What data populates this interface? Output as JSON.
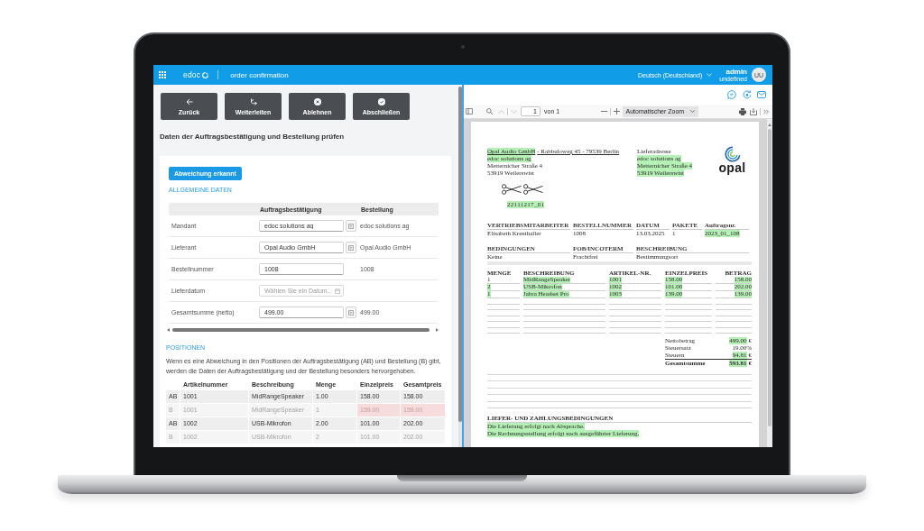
{
  "app_bar": {
    "product": "edoc",
    "title": "order confirmation",
    "language": "Deutsch (Deutschland)",
    "user": {
      "name": "admin",
      "role": "undefined",
      "initials": "UU"
    }
  },
  "actions": [
    {
      "kind": "back",
      "label": "Zurück"
    },
    {
      "kind": "forward",
      "label": "Weiterleiten"
    },
    {
      "kind": "reject",
      "label": "Ablehnen"
    },
    {
      "kind": "complete",
      "label": "Abschließen"
    }
  ],
  "heading": "Daten der Auftragsbestätigung und Bestellung prüfen",
  "status_button": "Abweichung erkannt",
  "general_data": {
    "title": "ALLGEMEINE DATEN",
    "columns": [
      "Auftragsbestätigung",
      "Bestellung"
    ],
    "rows": [
      {
        "label": "Mandant",
        "kind": "lookup",
        "value": "edoc solutions ag",
        "order_value": "edoc solutions ag"
      },
      {
        "label": "Lieferant",
        "kind": "lookup",
        "value": "Opal Audio GmbH",
        "order_value": "Opal Audio GmbH"
      },
      {
        "label": "Bestellnummer",
        "kind": "text",
        "value": "1008",
        "order_value": "1008"
      },
      {
        "label": "Lieferdatum",
        "kind": "date",
        "placeholder": "Wählen Sie ein Datum..."
      },
      {
        "label": "Gesamtsumme (netto)",
        "kind": "lookup",
        "value": "499.00",
        "order_value": "499.00"
      }
    ]
  },
  "positions": {
    "title": "POSITIONEN",
    "note": "Wenn es eine Abweichung in den Positionen der Auftragsbestätigung (AB) und Bestellung (B) gibt, werden die Daten der Auftragsbestätigung und der Bestellung besonders hervorgehoben.",
    "columns": [
      "Artikelnummer",
      "Beschreibung",
      "Menge",
      "Einzelpreis",
      "Gesamtpreis"
    ],
    "rows": [
      {
        "kind": "confirmation",
        "source": "AB",
        "cells": [
          {
            "text": "1001",
            "deviation": false
          },
          {
            "text": "MidRangeSpeaker",
            "deviation": false
          },
          {
            "text": "1.00",
            "deviation": false
          },
          {
            "text": "158.00",
            "deviation": false
          },
          {
            "text": "158.00",
            "deviation": false
          }
        ]
      },
      {
        "kind": "order",
        "source": "B",
        "cells": [
          {
            "text": "1001",
            "deviation": false
          },
          {
            "text": "MidRangeSpeaker",
            "deviation": false
          },
          {
            "text": "1",
            "deviation": false
          },
          {
            "text": "159.00",
            "deviation": true
          },
          {
            "text": "159.00",
            "deviation": true
          }
        ]
      },
      {
        "kind": "confirmation",
        "source": "AB",
        "cells": [
          {
            "text": "1002",
            "deviation": false
          },
          {
            "text": "USB-Mikrofon",
            "deviation": false
          },
          {
            "text": "2.00",
            "deviation": false
          },
          {
            "text": "101.00",
            "deviation": false
          },
          {
            "text": "202.00",
            "deviation": false
          }
        ]
      },
      {
        "kind": "order",
        "source": "B",
        "cells": [
          {
            "text": "1002",
            "deviation": false
          },
          {
            "text": "USB-Mikrofon",
            "deviation": false
          },
          {
            "text": "2",
            "deviation": false
          },
          {
            "text": "101.00",
            "deviation": false
          },
          {
            "text": "202.00",
            "deviation": false
          }
        ]
      }
    ]
  },
  "viewer": {
    "prev_page_disabled": true,
    "next_page_disabled": true,
    "page": "1",
    "page_count": "von 1",
    "zoom": "Automatischer Zoom"
  },
  "document": {
    "sender": {
      "name": {
        "text": "Opal Audio GmbH",
        "highlighted": true
      },
      "address": {
        "text": "- Rabbuloweg 45 - 79539 Berlin",
        "highlighted": false
      }
    },
    "recipient": [
      {
        "text": "edoc solutions ag",
        "highlighted": true
      },
      {
        "text": "Metternicher Straße 4",
        "highlighted": false
      },
      {
        "text": "53919 Weilerswist",
        "highlighted": false
      }
    ],
    "delivery_address": {
      "title": "Lieferadresse",
      "lines": [
        {
          "text": "edoc solutions ag",
          "highlighted": true
        },
        {
          "text": "Metternicher Straße 4",
          "highlighted": true
        },
        {
          "text": "53919 Weilerswist",
          "highlighted": true
        }
      ]
    },
    "logo_text": "opal",
    "reference": {
      "text": "22111217_01",
      "highlighted": true
    },
    "info_blocks": [
      [
        {
          "label": "VERTRIEBSMITARBEITER",
          "value": "Elisabeth Krenthaller",
          "highlighted": false
        },
        {
          "label": "BESTELLNUMMER",
          "value": "1008",
          "highlighted": false
        },
        {
          "label": "DATUM",
          "value": "13.03.2025",
          "highlighted": false
        },
        {
          "label": "PAKETE",
          "value": "1",
          "highlighted": false
        },
        {
          "label": "Auftragsnr.",
          "value": "2023_01_108",
          "highlighted": true
        }
      ],
      [
        {
          "label": "BEDINGUNGEN",
          "value": "Keine",
          "highlighted": false
        },
        {
          "label": "FOB/INCOTERM",
          "value": "Frachtfrei",
          "highlighted": false
        },
        {
          "label": "BESCHREIBUNG",
          "value": "Bestimmungsort",
          "highlighted": false
        }
      ]
    ],
    "items": {
      "columns": [
        "MENGE",
        "BESCHREIBUNG",
        "ARTIKEL-NR.",
        "EINZELPREIS",
        "BETRAG"
      ],
      "rows": [
        [
          {
            "text": "1",
            "highlighted": false
          },
          {
            "text": "MidRangeSpeaker",
            "highlighted": true
          },
          {
            "text": "1001",
            "highlighted": true
          },
          {
            "text": "158.00",
            "highlighted": true
          },
          {
            "text": "158.00",
            "highlighted": true
          }
        ],
        [
          {
            "text": "2",
            "highlighted": true
          },
          {
            "text": "USB-Mikrofon",
            "highlighted": true
          },
          {
            "text": "1002",
            "highlighted": true
          },
          {
            "text": "101.00",
            "highlighted": true
          },
          {
            "text": "202.00",
            "highlighted": true
          }
        ],
        [
          {
            "text": "1",
            "highlighted": true
          },
          {
            "text": "Jabra Headset Pro",
            "highlighted": true
          },
          {
            "text": "1003",
            "highlighted": true
          },
          {
            "text": "139.00",
            "highlighted": true
          },
          {
            "text": "139.00",
            "highlighted": true
          }
        ]
      ]
    },
    "totals": [
      {
        "kind": "line",
        "label": "Nettobetrag",
        "amount": "499.00",
        "currency": "€",
        "highlighted": true
      },
      {
        "kind": "line",
        "label": "Steuersatz",
        "amount": "19.00%",
        "highlighted": false
      },
      {
        "kind": "line",
        "label": "Steuern",
        "amount": "94.81",
        "currency": "€",
        "highlighted": true
      },
      {
        "kind": "total",
        "label": "Gesamtsumme",
        "amount": "593.81",
        "currency": "€",
        "highlighted": true
      }
    ],
    "terms": {
      "title": "LIEFER- UND ZAHLUNGSBEDINGUNGEN",
      "lines": [
        {
          "text": "Die Lieferung erfolgt nach Absprache.",
          "highlighted": true
        },
        {
          "text": "Die Rechnungsstellung erfolgt nach ausgeführter Lieferung.",
          "highlighted": true
        }
      ]
    }
  }
}
